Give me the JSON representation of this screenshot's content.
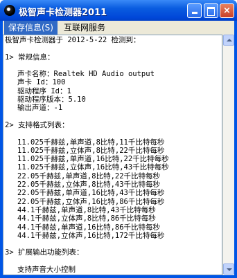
{
  "window": {
    "title": "极智声卡检测器2011",
    "colors": {
      "titlebar": "#0a5ce0",
      "menu_active": "#316ac5",
      "close_button": "#c8402a"
    },
    "controls": {
      "minimize": "minimize-icon",
      "maximize": "maximize-icon",
      "close": "×"
    }
  },
  "menu": {
    "items": [
      {
        "label": "保存信息(S)",
        "active": true
      },
      {
        "label": "互联网服务",
        "active": false
      }
    ]
  },
  "report": {
    "header": "极智声卡检测器于 2012-5-22 检测到：",
    "section1_title": "1> 常规信息：",
    "general": [
      "声卡名称：Realtek HD Audio output",
      "声卡 Id：100",
      "驱动程序 Id：1",
      "驱动程序版本：5.10",
      "输出声道：-1"
    ],
    "section2_title": "2> 支持格式列表：",
    "formats": [
      "11.025千赫兹,单声道,8比特,11千比特每秒",
      "11.025千赫兹,立体声,8比特,22千比特每秒",
      "11.025千赫兹,单声道,16比特,22千比特每秒",
      "11.025千赫兹,立体声,16比特,43千比特每秒",
      "22.05千赫兹,单声道,8比特,22千比特每秒",
      "22.05千赫兹,立体声,8比特,43千比特每秒",
      "22.05千赫兹,单声道,16比特,43千比特每秒",
      "22.05千赫兹,立体声,16比特,86千比特每秒",
      "44.1千赫兹,单声道,8比特,43千比特每秒",
      "44.1千赫兹,立体声,8比特,86千比特每秒",
      "44.1千赫兹,单声道,16比特,86千比特每秒",
      "44.1千赫兹,立体声,16比特,172千比特每秒"
    ],
    "section3_title": "3> 扩展输出功能列表：",
    "extended": [
      "支持声音大小控制"
    ]
  }
}
